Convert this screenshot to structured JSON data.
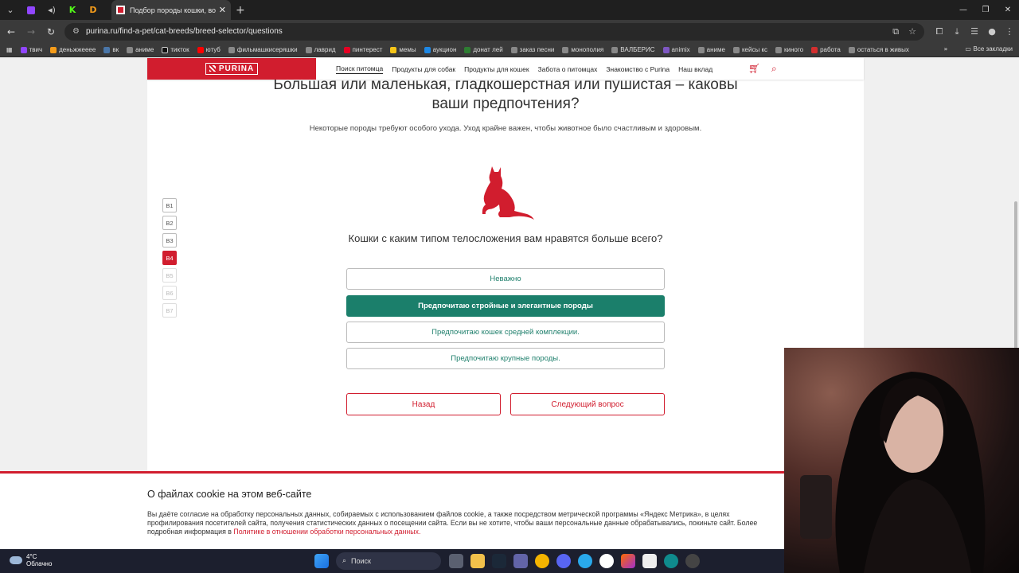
{
  "browser": {
    "tab_title": "Подбор породы кошки, вопр",
    "url": "purina.ru/find-a-pet/cat-breeds/breed-selector/questions",
    "bookmarks": [
      "твич",
      "деньжжееее",
      "вк",
      "аниме",
      "тикток",
      "ютуб",
      "фильмашкисеряшки",
      "лаврид",
      "пинтерест",
      "мемы",
      "аукцион",
      "донат лей",
      "заказ песни",
      "монополия",
      "ВАЛБЕРИС",
      "animix",
      "аниме",
      "кейсы кс",
      "киного",
      "работа",
      "остаться в живых"
    ],
    "bookmarks_all": "Все закладки"
  },
  "site": {
    "logo": "PURINA",
    "menu": [
      "Поиск питомца",
      "Продукты для собак",
      "Продукты для кошек",
      "Забота о питомцах",
      "Знакомство с Purina",
      "Наш вклад"
    ],
    "accent": "#d11d2e",
    "teal": "#1b7f6b"
  },
  "quiz": {
    "title_line1": "Большая или маленькая, гладкошерстная или пушистая – каковы",
    "title_line2": "ваши предпочтения?",
    "subtitle": "Некоторые породы требуют особого ухода. Уход крайне важен, чтобы животное было счастливым и здоровым.",
    "question": "Кошки с каким типом телосложения вам нравятся больше всего?",
    "steps": [
      "В1",
      "В2",
      "В3",
      "В4",
      "В5",
      "В6",
      "В7"
    ],
    "current_step": "В4",
    "options": [
      "Неважно",
      "Предпочитаю стройные и элегантные породы",
      "Предпочитаю кошек средней комплекции.",
      "Предпочитаю крупные породы."
    ],
    "selected_option": "Предпочитаю стройные и элегантные породы",
    "back": "Назад",
    "next": "Следующий вопрос"
  },
  "cookie": {
    "title": "О файлах cookie на этом веб-сайте",
    "text": "Вы даёте согласие на обработку персональных данных, собираемых с использованием файлов cookie, а также посредством метрической программы «Яндекс Метрика», в целях профилирования посетителей сайта, получения статистических данных о посещении сайта. Если вы не хотите, чтобы ваши персональные данные обрабатывались, покиньте сайт. Более подробная информация в ",
    "link": "Политике в отношении обработки персональных данных."
  },
  "taskbar": {
    "temp": "4°C",
    "weather": "Облачно",
    "search": "Поиск"
  }
}
